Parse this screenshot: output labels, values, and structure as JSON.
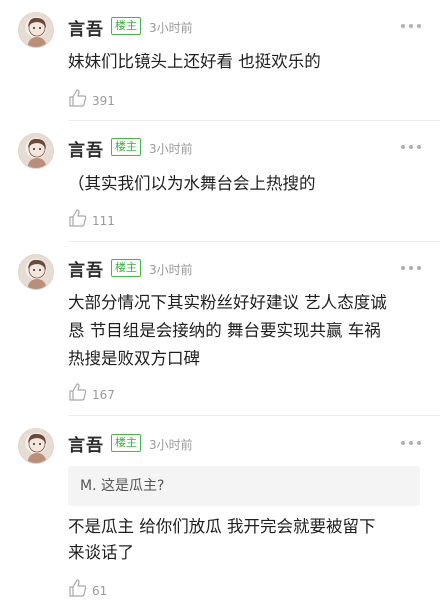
{
  "comments": [
    {
      "username": "言吾",
      "badge": "楼主",
      "time": "3小时前",
      "text": "妹妹们比镜头上还好看 也挺欢乐的",
      "likes": "391"
    },
    {
      "username": "言吾",
      "badge": "楼主",
      "time": "3小时前",
      "text": "（其实我们以为水舞台会上热搜的",
      "likes": "111"
    },
    {
      "username": "言吾",
      "badge": "楼主",
      "time": "3小时前",
      "text_lines": [
        "大部分情况下其实粉丝好好建议 艺人态度诚",
        "恳 节目组是会接纳的 舞台要实现共赢 车祸",
        "热搜是败双方口碑"
      ],
      "likes": "167"
    },
    {
      "username": "言吾",
      "badge": "楼主",
      "time": "3小时前",
      "quote": "M. 这是瓜主?",
      "text_lines": [
        "不是瓜主 给你们放瓜 我开完会就要被留下",
        "来谈话了"
      ],
      "likes": "61"
    }
  ],
  "icons": {
    "more": "more-dots-icon",
    "like": "thumbs-up-icon"
  },
  "colors": {
    "badge": "#3cae3c",
    "muted": "#9a9a9a",
    "divider": "#ececec"
  }
}
